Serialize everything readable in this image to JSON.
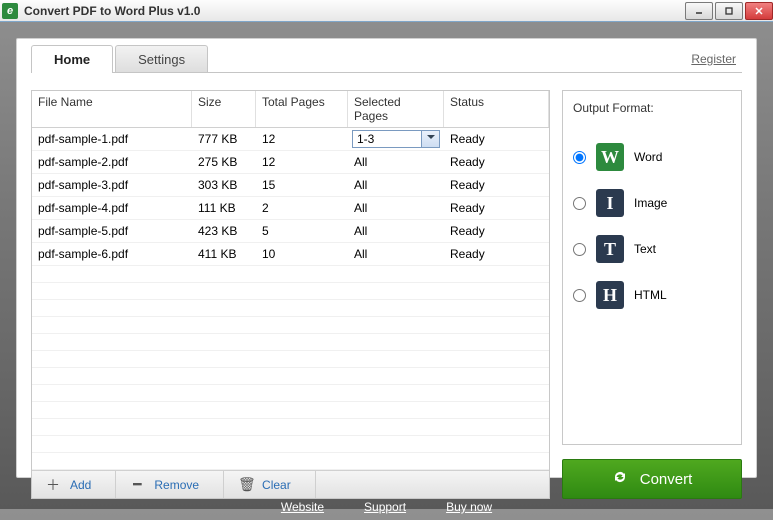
{
  "window": {
    "title": "Convert PDF to Word Plus v1.0"
  },
  "tabs": {
    "home": "Home",
    "settings": "Settings"
  },
  "register": "Register",
  "columns": {
    "file_name": "File Name",
    "size": "Size",
    "total_pages": "Total Pages",
    "selected_pages": "Selected Pages",
    "status": "Status"
  },
  "rows": [
    {
      "file": "pdf-sample-1.pdf",
      "size": "777 KB",
      "total": "12",
      "selected": "1-3",
      "status": "Ready",
      "dropdown": true
    },
    {
      "file": "pdf-sample-2.pdf",
      "size": "275 KB",
      "total": "12",
      "selected": "All",
      "status": "Ready",
      "dropdown": false
    },
    {
      "file": "pdf-sample-3.pdf",
      "size": "303 KB",
      "total": "15",
      "selected": "All",
      "status": "Ready",
      "dropdown": false
    },
    {
      "file": "pdf-sample-4.pdf",
      "size": "111 KB",
      "total": "2",
      "selected": "All",
      "status": "Ready",
      "dropdown": false
    },
    {
      "file": "pdf-sample-5.pdf",
      "size": "423 KB",
      "total": "5",
      "selected": "All",
      "status": "Ready",
      "dropdown": false
    },
    {
      "file": "pdf-sample-6.pdf",
      "size": "411 KB",
      "total": "10",
      "selected": "All",
      "status": "Ready",
      "dropdown": false
    }
  ],
  "toolbar": {
    "add": "Add",
    "remove": "Remove",
    "clear": "Clear"
  },
  "output": {
    "title": "Output Format:",
    "formats": [
      {
        "key": "word",
        "label": "Word",
        "letter": "W",
        "selected": true
      },
      {
        "key": "image",
        "label": "Image",
        "letter": "I",
        "selected": false
      },
      {
        "key": "text",
        "label": "Text",
        "letter": "T",
        "selected": false
      },
      {
        "key": "html",
        "label": "HTML",
        "letter": "H",
        "selected": false
      }
    ]
  },
  "convert": "Convert",
  "footer": {
    "website": "Website",
    "support": "Support",
    "buy": "Buy now"
  }
}
